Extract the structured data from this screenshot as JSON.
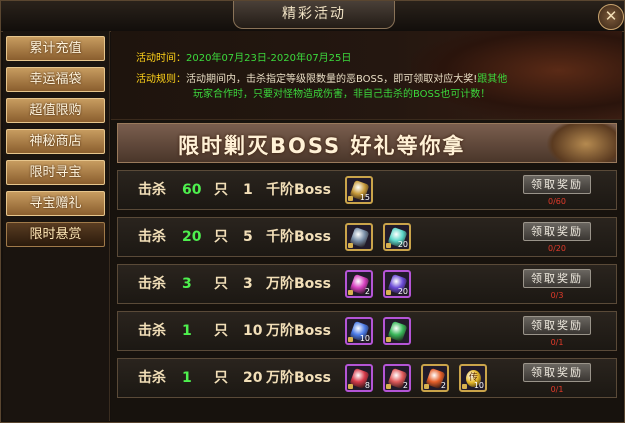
{
  "window": {
    "title": "精彩活动",
    "close_label": "✕"
  },
  "sidebar": {
    "tabs": [
      {
        "label": "累计充值",
        "active": false
      },
      {
        "label": "幸运福袋",
        "active": false
      },
      {
        "label": "超值限购",
        "active": false
      },
      {
        "label": "神秘商店",
        "active": false
      },
      {
        "label": "限时寻宝",
        "active": false
      },
      {
        "label": "寻宝赠礼",
        "active": false
      },
      {
        "label": "限时悬赏",
        "active": true
      }
    ]
  },
  "info": {
    "time_label": "活动时间：",
    "time_value": "2020年07月23日-2020年07月25日",
    "rules_label": "活动规则：",
    "rules_line1": "活动期间内，击杀指定等级限数量的恶BOSS，即可领取对应大奖!",
    "rules_line1_green": "跟其他",
    "rules_line2": "玩家合作时，只要对怪物造成伤害，非自己击杀的BOSS也可计数！"
  },
  "banner": {
    "text": "限时剿灭BOSS  好礼等你拿"
  },
  "rows": [
    {
      "kill_label": "击杀",
      "count": "60",
      "unit": "只",
      "level": "1",
      "boss": "千阶Boss",
      "claim_label": "领取奖励",
      "progress": "0/60",
      "rewards": [
        {
          "icon": "treasure-chest-icon",
          "qty": "15"
        }
      ]
    },
    {
      "kill_label": "击杀",
      "count": "20",
      "unit": "只",
      "level": "5",
      "boss": "千阶Boss",
      "claim_label": "领取奖励",
      "progress": "0/20",
      "rewards": [
        {
          "icon": "shield-orb-icon",
          "qty": ""
        },
        {
          "icon": "crystal-icon",
          "qty": "20"
        }
      ]
    },
    {
      "kill_label": "击杀",
      "count": "3",
      "unit": "只",
      "level": "3",
      "boss": "万阶Boss",
      "claim_label": "领取奖励",
      "progress": "0/3",
      "rewards": [
        {
          "icon": "pink-gem-icon",
          "qty": "2"
        },
        {
          "icon": "purple-crystal-icon",
          "qty": "20"
        }
      ]
    },
    {
      "kill_label": "击杀",
      "count": "1",
      "unit": "只",
      "level": "10",
      "boss": "万阶Boss",
      "claim_label": "领取奖励",
      "progress": "0/1",
      "rewards": [
        {
          "icon": "blue-feather-icon",
          "qty": "10"
        },
        {
          "icon": "green-crystal-icon",
          "qty": ""
        }
      ]
    },
    {
      "kill_label": "击杀",
      "count": "1",
      "unit": "只",
      "level": "20",
      "boss": "万阶Boss",
      "claim_label": "领取奖励",
      "progress": "0/1",
      "rewards": [
        {
          "icon": "ruby-box-icon",
          "qty": "8"
        },
        {
          "icon": "red-crystal-icon",
          "qty": "2"
        },
        {
          "icon": "fire-orb-icon",
          "qty": "2"
        },
        {
          "icon": "gold-coin-icon",
          "qty": "10",
          "text": "传"
        }
      ]
    }
  ],
  "colors": {
    "accent": "#ffd21a",
    "count_green": "#4ef04e",
    "progress_red": "#e23a2a"
  }
}
